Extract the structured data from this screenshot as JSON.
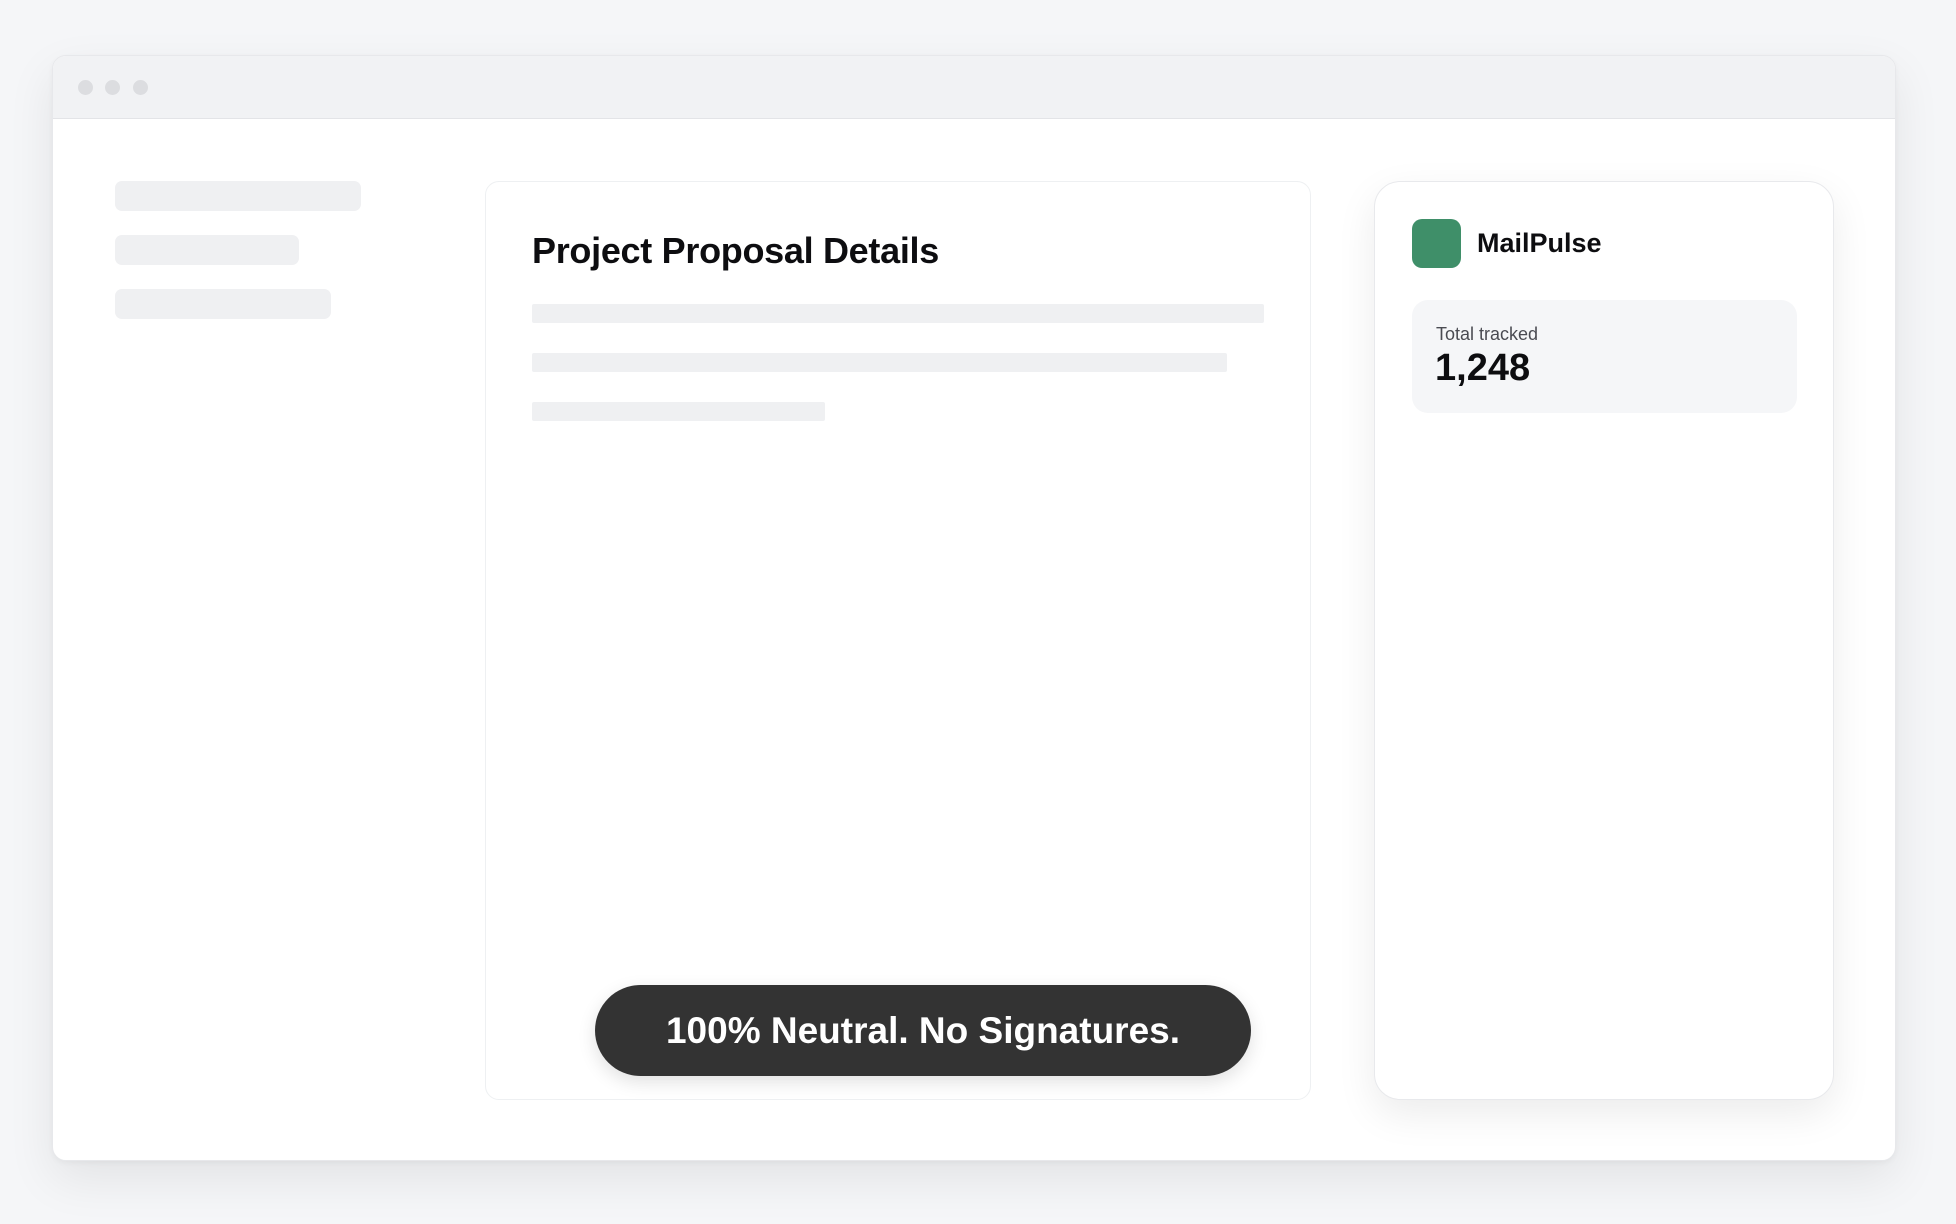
{
  "document": {
    "title": "Project Proposal Details"
  },
  "toast": {
    "message": "100% Neutral. No Signatures."
  },
  "widget": {
    "brand": {
      "name": "MailPulse",
      "logo_color": "#3f8f69"
    },
    "stat": {
      "label": "Total tracked",
      "value": "1,248"
    }
  }
}
